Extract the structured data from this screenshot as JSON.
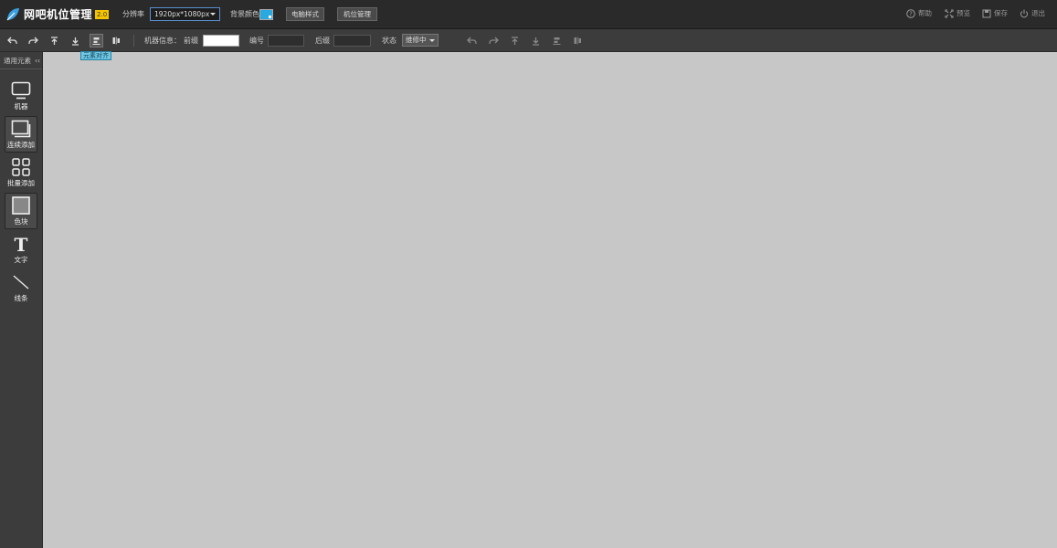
{
  "header": {
    "app_title": "网吧机位管理",
    "version": "2.0",
    "resolution_label": "分辨率",
    "resolution_value": "1920px*1080px",
    "bg_color_label": "背景颜色",
    "bg_color": "#2aa8e0",
    "buttons": {
      "pc_style": "电脑样式",
      "seat_manage": "机位管理"
    },
    "right": {
      "help": "帮助",
      "preview": "预览",
      "save": "保存",
      "exit": "退出"
    }
  },
  "toolbar": {
    "info_label": "机器信息：",
    "prefix_label": "前缀",
    "number_label": "编号",
    "suffix_label": "后缀",
    "status_label": "状态",
    "status_value": "维修中",
    "prefix_value": "",
    "number_value": "",
    "suffix_value": "",
    "tooltip": "元素对齐"
  },
  "sidebar": {
    "title": "通用元素",
    "collapse": "‹‹",
    "items": [
      {
        "label": "机器",
        "icon": "monitor-icon"
      },
      {
        "label": "连续添加",
        "icon": "stack-icon"
      },
      {
        "label": "批量添加",
        "icon": "grid-icon"
      },
      {
        "label": "色块",
        "icon": "color-block-icon"
      },
      {
        "label": "文字",
        "icon": "text-icon"
      },
      {
        "label": "线条",
        "icon": "line-icon"
      }
    ]
  }
}
